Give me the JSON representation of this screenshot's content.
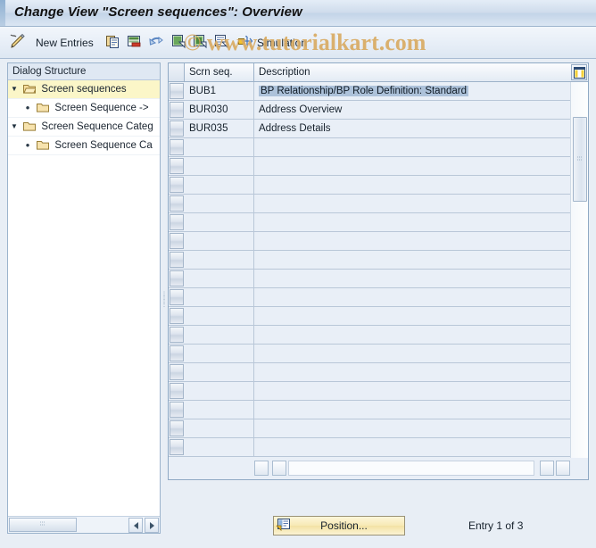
{
  "window": {
    "title": "Change View \"Screen sequences\": Overview"
  },
  "watermark": {
    "text": "© www.tutorialkart.com"
  },
  "toolbar": {
    "items": [
      {
        "name": "display-change-icon",
        "label": ""
      },
      {
        "name": "new-entries-button",
        "label": "New Entries"
      },
      {
        "name": "copy-as-icon",
        "label": ""
      },
      {
        "name": "delete-icon",
        "label": ""
      },
      {
        "name": "undo-icon",
        "label": ""
      },
      {
        "name": "select-all-icon",
        "label": ""
      },
      {
        "name": "deselect-all-icon",
        "label": ""
      },
      {
        "name": "select-block-icon",
        "label": ""
      },
      {
        "name": "simulation-icon",
        "label": "Simulation"
      }
    ],
    "new_entries_label": "New Entries",
    "simulation_label": "Simulation"
  },
  "sidebar": {
    "header": "Dialog Structure",
    "items": [
      {
        "label": "Screen sequences",
        "level": 0,
        "expander": "▼",
        "selected": true
      },
      {
        "label": "Screen Sequence ->",
        "level": 1,
        "expander": "•",
        "selected": false
      },
      {
        "label": "Screen Sequence Categ",
        "level": 0,
        "expander": "▼",
        "selected": false
      },
      {
        "label": "Screen Sequence Ca",
        "level": 1,
        "expander": "•",
        "selected": false
      }
    ]
  },
  "table": {
    "columns": [
      "Scrn seq.",
      "Description"
    ],
    "rows": [
      {
        "scrn_seq": "BUB1",
        "description": "BP Relationship/BP Role Definition: Standard",
        "selected": true
      },
      {
        "scrn_seq": "BUR030",
        "description": "Address Overview",
        "selected": false
      },
      {
        "scrn_seq": "BUR035",
        "description": "Address Details",
        "selected": false
      }
    ],
    "empty_row_count": 17
  },
  "footer": {
    "position_button": "Position...",
    "entry_status": "Entry 1 of 3"
  },
  "colors": {
    "title_bar": "#c3d4e8",
    "selection": "#adc2da",
    "tree_selected": "#fbf6c8",
    "watermark": "#d9ab63",
    "button_yellow": "#f3e2a4"
  }
}
